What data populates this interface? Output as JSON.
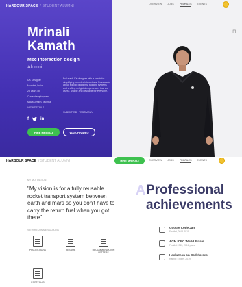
{
  "brand": "HARBOUR SPACE",
  "breadcrumb": "/ STUDENT ALUMNI",
  "nav": [
    "OVERVIEW",
    "JOBS",
    "PROFILES",
    "EVENTS"
  ],
  "profile": {
    "first_name": "Mrinali",
    "last_name": "Kamath",
    "degree": "Msc Interaction design",
    "role": "Alumni",
    "details": [
      "UX Designer",
      "Mumbai, India",
      "25 years old",
      "",
      "Current employment",
      "Maya Design, Mumbai",
      "",
      "VIEW DETAILS"
    ],
    "bio": "Full stack UX designer with a knack for simplifying complex interactions. Passionate about solving problems, building systems and crafting delightful experiences that are useful, usable and desirable for everyone.",
    "bio_link": "SUBMITTED · TESTIMONY",
    "social": [
      "f",
      "t",
      "in"
    ],
    "hire_label": "HIRE MRINALI",
    "video_label": "WATCH VIDEO"
  },
  "vision": {
    "label": "MY MOTIVATION",
    "quote": "\"My vision is for a fully reusable rocket transport system between earth and mars so you don't have to carry the return fuel when you got there\""
  },
  "recommendations": {
    "label": "VIEW RECOMMENDATIONS",
    "items": [
      "PROJECTIONS",
      "RESUME",
      "RECOMMENDATION LETTERS",
      "PORTFOLIO"
    ]
  },
  "achievements": {
    "title_line1": "Professional",
    "title_line2": "achievements",
    "items": [
      {
        "title": "Google Code Jam",
        "sub": "Finalist, 2014-2015"
      },
      {
        "title": "ACM ICPC World Finals",
        "sub": "Finalist 2015, 2016 place"
      },
      {
        "title": "Hackathon on Codeforces",
        "sub": "Rating: Expert, 2019"
      }
    ]
  },
  "colors": {
    "purple": "#4a36bb",
    "green": "#3ec14f",
    "title": "#3a3a66"
  }
}
